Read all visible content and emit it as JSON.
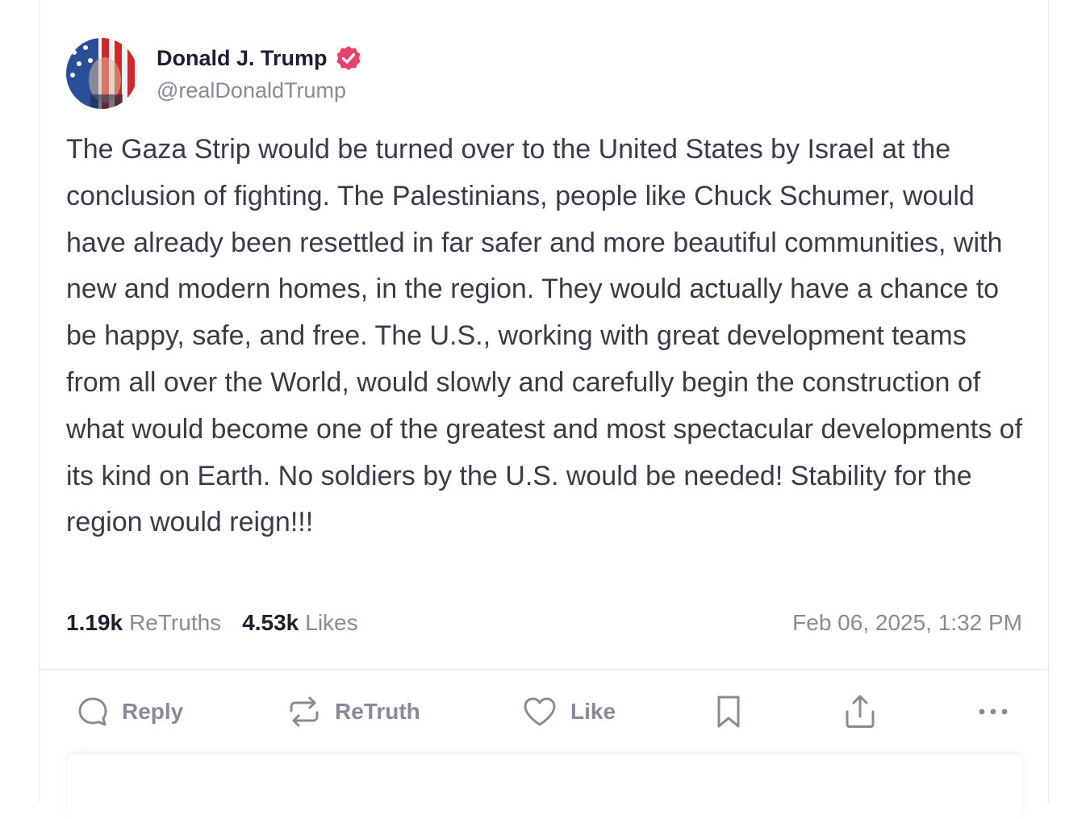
{
  "post": {
    "author": {
      "display_name": "Donald J. Trump",
      "handle": "@realDonaldTrump",
      "verified": true,
      "verified_color": "#e8426b"
    },
    "text": "The Gaza Strip would be turned over to the United States by Israel at the conclusion of fighting. The Palestinians, people like Chuck Schumer, would have already been resettled in far safer and more beautiful communities, with new and modern homes, in the region. They would actually have a chance to be happy, safe, and free. The U.S., working with great development teams from all over the World, would slowly and carefully begin the construction of what would become one of the greatest and most spectacular developments of its kind on Earth. No soldiers by the U.S. would be needed! Stability for the region would reign!!!",
    "stats": {
      "retruths_count": "1.19k",
      "retruths_label": "ReTruths",
      "likes_count": "4.53k",
      "likes_label": "Likes"
    },
    "timestamp": "Feb 06, 2025, 1:32 PM"
  },
  "actions": {
    "reply": {
      "label": "Reply",
      "icon": "speech-bubble-icon"
    },
    "retruth": {
      "label": "ReTruth",
      "icon": "repost-arrows-icon"
    },
    "like": {
      "label": "Like",
      "icon": "heart-icon"
    },
    "bookmark": {
      "icon": "bookmark-icon"
    },
    "share": {
      "icon": "share-upload-icon"
    },
    "more": {
      "icon": "ellipsis-icon"
    }
  },
  "colors": {
    "text_primary": "#1f1d33",
    "text_body": "#3b3a4a",
    "text_muted": "#8a8999",
    "border": "#e7e7ee"
  }
}
